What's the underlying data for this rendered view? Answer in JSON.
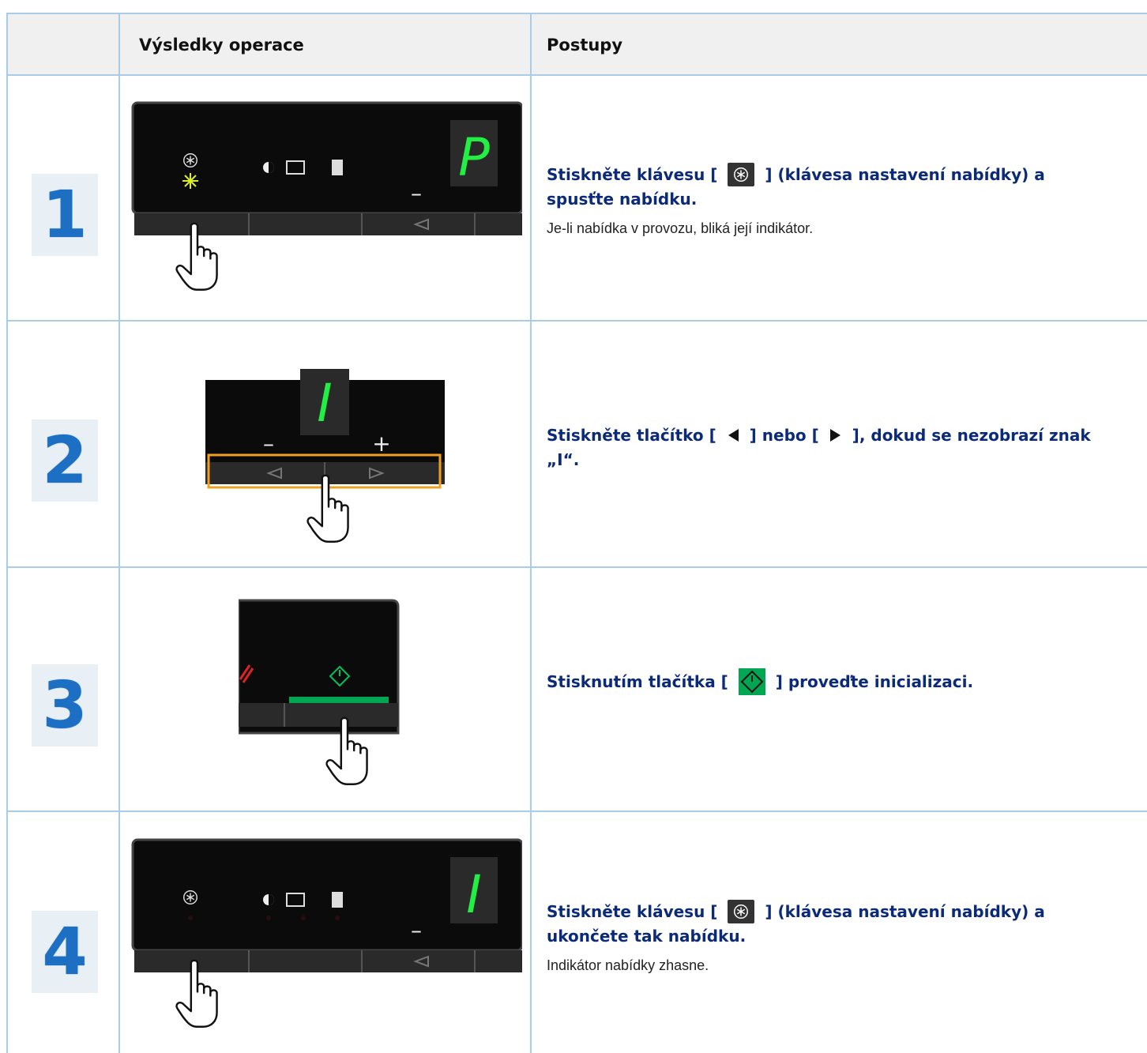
{
  "header": {
    "col_results": "Výsledky operace",
    "col_procedures": "Postupy"
  },
  "steps": [
    {
      "number": "1",
      "title_a": "Stiskněte klávesu [",
      "title_b": "] (klávesa nastavení nabídky) a spusťte nabídku.",
      "note": "Je-li nabídka v provozu, bliká její indikátor.",
      "display_char": "P",
      "minus_label": "–"
    },
    {
      "number": "2",
      "title_a": "Stiskněte tlačítko [",
      "title_b": "] nebo [",
      "title_c": "], dokud se nezobrazí znak „I“.",
      "display_char": "I",
      "minus_label": "–",
      "plus_label": "+"
    },
    {
      "number": "3",
      "title_a": "Stisknutím tlačítka [",
      "title_b": "] proveďte inicializaci."
    },
    {
      "number": "4",
      "title_a": "Stiskněte klávesu [",
      "title_b": "] (klávesa nastavení nabídky) a ukončete tak nabídku.",
      "note": "Indikátor nabídky zhasne.",
      "display_char": "I",
      "minus_label": "–"
    }
  ],
  "colors": {
    "title_text": "#0c2a7a",
    "step_number": "#1d6fc3",
    "grid_line": "#a9cde8",
    "display_green": "#22ee44",
    "start_green": "#00a651",
    "highlight_orange": "#f0a020"
  },
  "icons": {
    "menu_key": "menu-asterisk-icon",
    "left_arrow": "left-triangle-icon",
    "right_arrow": "right-triangle-icon",
    "start_key": "start-diamond-icon",
    "hand": "pointing-hand-icon"
  }
}
